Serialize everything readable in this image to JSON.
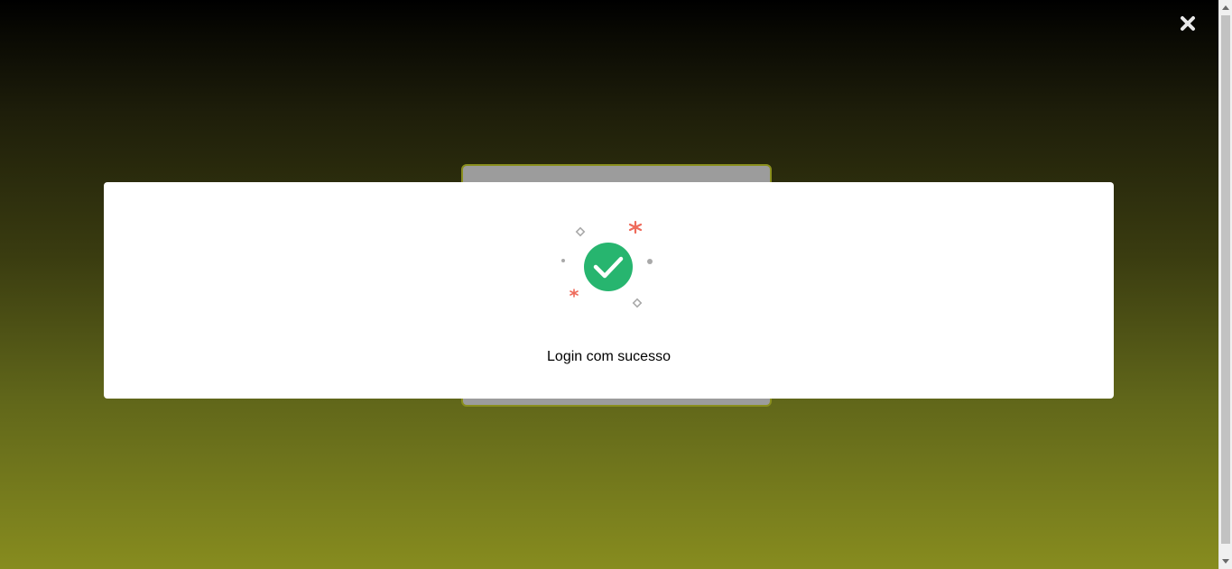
{
  "modal": {
    "message": "Login com sucesso",
    "icon": "check-circle-icon",
    "icon_color": "#27b56f",
    "confetti_colors": [
      "#ee6b5b",
      "#a9a9a9"
    ]
  },
  "overlay": {
    "close_icon": "close-icon",
    "gradient_top": "#000000",
    "gradient_bottom": "#878c1f"
  }
}
